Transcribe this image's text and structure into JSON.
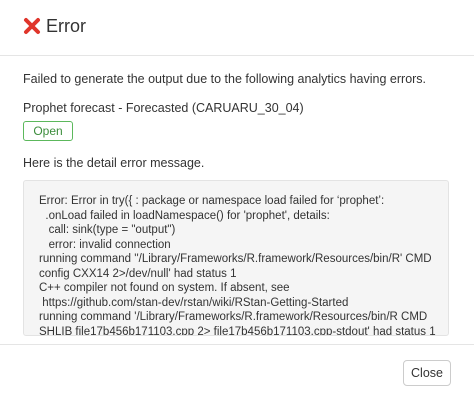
{
  "dialog": {
    "title": "Error",
    "message": "Failed to generate the output due to the following analytics having errors.",
    "analytic": "Prophet forecast - Forecasted (CARUARU_30_04)",
    "open_label": "Open",
    "detail_label": "Here is the detail error message.",
    "error_lines": [
      "Error: Error in try({ : package or namespace load failed for ‘prophet’:",
      "  .onLoad failed in loadNamespace() for 'prophet', details:",
      "   call: sink(type = \"output\")",
      "   error: invalid connection",
      "running command ''/Library/Frameworks/R.framework/Resources/bin/R' CMD",
      "config CXX14 2>/dev/null' had status 1",
      "C++ compiler not found on system. If absent, see",
      " https://github.com/stan-dev/rstan/wiki/RStan-Getting-Started",
      "running command '/Library/Frameworks/R.framework/Resources/bin/R CMD",
      "SHLIB file17b456b171103.cpp 2> file17b456b171103.cpp-stdout' had status 1"
    ],
    "close_label": "Close",
    "error_icon_color": "#e0352b",
    "open_color": "#5cb85c"
  }
}
